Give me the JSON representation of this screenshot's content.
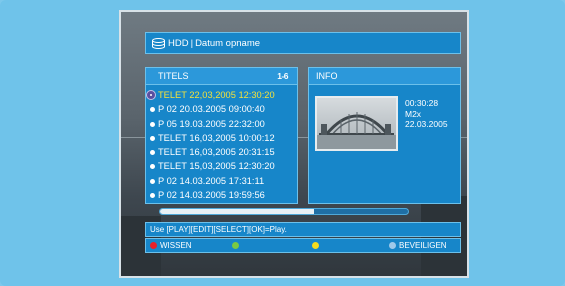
{
  "header": {
    "icon": "hdd-icon",
    "source": "HDD",
    "separator": "|",
    "title": "Datum opname"
  },
  "titles_panel": {
    "heading": "TITELS",
    "count": "1-6",
    "recordings": [
      {
        "label": "TELET 22,03,2005 12:30:20",
        "selected": true
      },
      {
        "label": "P 02 20.03.2005 09:00:40",
        "selected": false
      },
      {
        "label": "P 05 19.03.2005 22:32:00",
        "selected": false
      },
      {
        "label": "TELET 16,03,2005 10:00:12",
        "selected": false
      },
      {
        "label": "TELET 16,03,2005 20:31:15",
        "selected": false
      },
      {
        "label": "TELET 15,03,2005 12:30:20",
        "selected": false
      },
      {
        "label": "P 02 14.03.2005 17:31:11",
        "selected": false
      },
      {
        "label": "P 02 14.03.2005 19:59:56",
        "selected": false
      }
    ]
  },
  "info_panel": {
    "heading": "INFO",
    "duration": "00:30:28",
    "quality": "M2x",
    "date": "22.03.2005"
  },
  "disk_usage": {
    "fill_fraction": 0.62
  },
  "help_text": "Use [PLAY][EDIT][SELECT][OK]=Play.",
  "color_buttons": {
    "red": {
      "label": "WISSEN",
      "color": "#e8202a"
    },
    "green": {
      "label": "",
      "color": "#7ac943"
    },
    "yellow": {
      "label": "",
      "color": "#f5dc1e"
    },
    "blue": {
      "label": "BEVEILIGEN",
      "color": "#9fc9ea"
    }
  }
}
